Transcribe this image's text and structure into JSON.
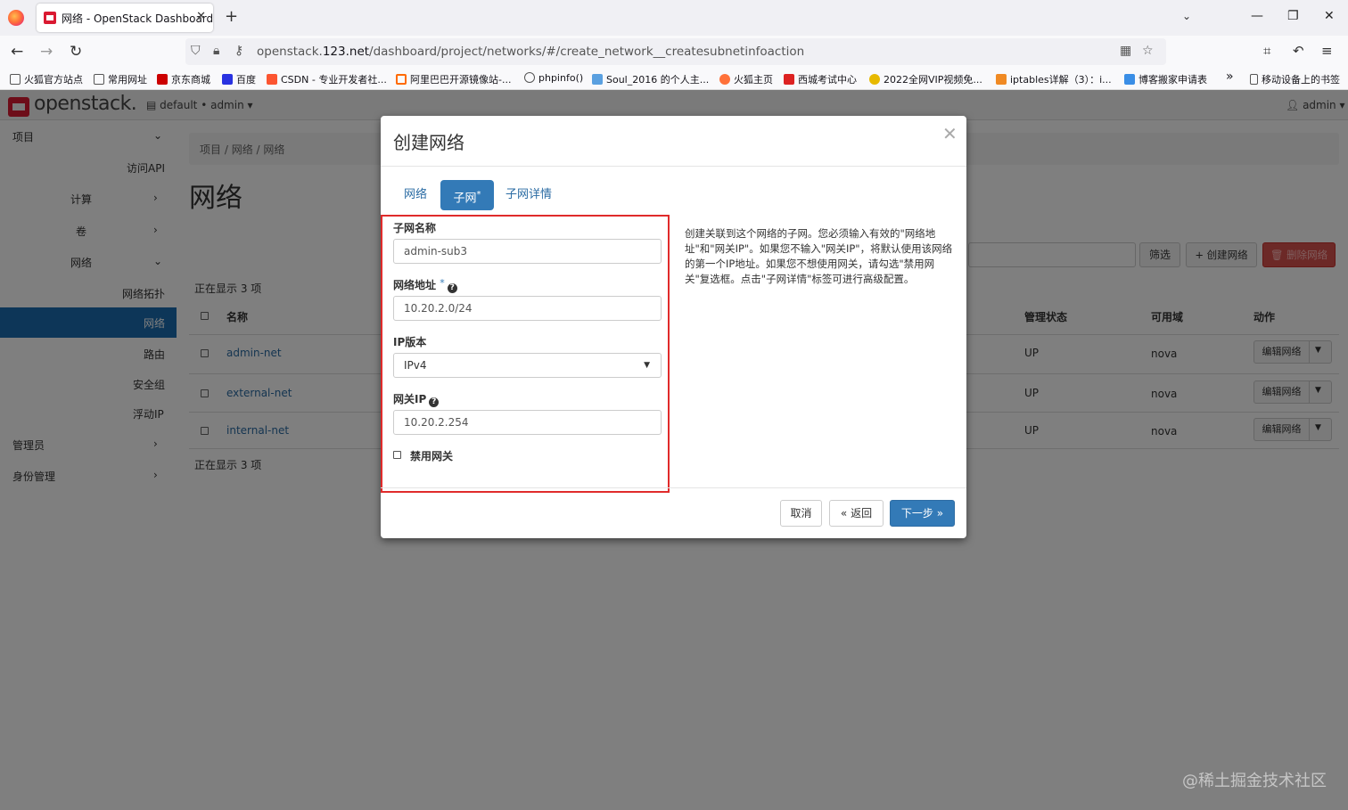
{
  "browser": {
    "tab_title": "网络 - OpenStack Dashboard",
    "url_prefix": "openstack.",
    "url_host": "123.net",
    "url_path": "/dashboard/project/networks/#/create_network__createsubnetinfoaction",
    "bookmarks": [
      "火狐官方站点",
      "常用网址",
      "京东商城",
      "百度",
      "CSDN - 专业开发者社...",
      "阿里巴巴开源镜像站-...",
      "phpinfo()",
      "Soul_2016 的个人主...",
      "火狐主页",
      "西城考试中心",
      "2022全网VIP视频免...",
      "iptables详解（3）：i...",
      "博客搬家申请表",
      "移动设备上的书签"
    ]
  },
  "header": {
    "logo": "openstack.",
    "project_selector": "default • admin",
    "user": "admin"
  },
  "sidebar": {
    "project": "项目",
    "access_api": "访问API",
    "compute": "计算",
    "volumes": "卷",
    "network": "网络",
    "network_topology": "网络拓扑",
    "networks": "网络",
    "routers": "路由",
    "security_groups": "安全组",
    "floating_ips": "浮动IP",
    "admin": "管理员",
    "identity": "身份管理"
  },
  "main": {
    "breadcrumb": [
      "项目",
      "网络",
      "网络"
    ],
    "title": "网络",
    "count_text": "正在显示 3 项",
    "filter_button": "筛选",
    "create_button": "+ 创建网络",
    "delete_button": "删除网络",
    "columns": {
      "name": "名称",
      "admin_state": "管理状态",
      "availability_zone": "可用域",
      "actions": "动作"
    },
    "rows": [
      {
        "name": "admin-net",
        "state": "UP",
        "zone": "nova",
        "action": "编辑网络"
      },
      {
        "name": "external-net",
        "state": "UP",
        "zone": "nova",
        "action": "编辑网络"
      },
      {
        "name": "internal-net",
        "state": "UP",
        "zone": "nova",
        "action": "编辑网络"
      }
    ]
  },
  "modal": {
    "title": "创建网络",
    "tabs": {
      "network": "网络",
      "subnet": "子网",
      "subnet_details": "子网详情"
    },
    "subnet_name_label": "子网名称",
    "subnet_name_value": "admin-sub3",
    "network_address_label": "网络地址",
    "network_address_value": "10.20.2.0/24",
    "ip_version_label": "IP版本",
    "ip_version_value": "IPv4",
    "gateway_ip_label": "网关IP",
    "gateway_ip_value": "10.20.2.254",
    "disable_gateway_label": "禁用网关",
    "help_text": "创建关联到这个网络的子网。您必须输入有效的\"网络地址\"和\"网关IP\"。如果您不输入\"网关IP\"，将默认使用该网络的第一个IP地址。如果您不想使用网关，请勾选\"禁用网关\"复选框。点击\"子网详情\"标签可进行高级配置。",
    "cancel_button": "取消",
    "back_button": "« 返回",
    "next_button": "下一步 »"
  },
  "watermark": "@稀土掘金技术社区"
}
